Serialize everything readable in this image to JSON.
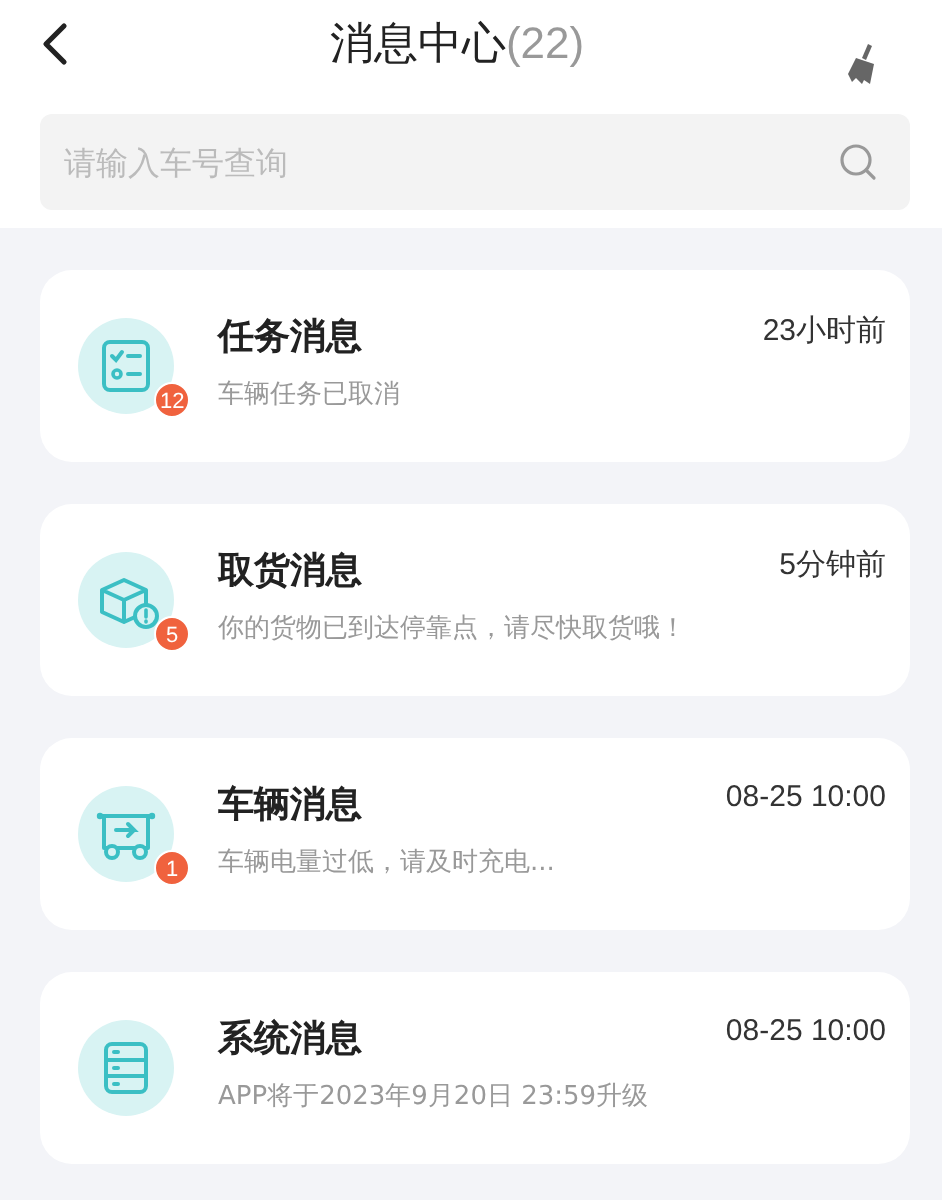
{
  "header": {
    "title": "消息中心",
    "count": "(22)"
  },
  "search": {
    "placeholder": "请输入车号查询"
  },
  "messages": [
    {
      "kind": "task",
      "title": "任务消息",
      "time": "23小时前",
      "preview": "车辆任务已取消",
      "badge": "12"
    },
    {
      "kind": "pickup",
      "title": "取货消息",
      "time": "5分钟前",
      "preview": "你的货物已到达停靠点，请尽快取货哦！",
      "badge": "5"
    },
    {
      "kind": "vehicle",
      "title": "车辆消息",
      "time": "08-25 10:00",
      "preview": "车辆电量过低，请及时充电...",
      "badge": "1"
    },
    {
      "kind": "system",
      "title": "系统消息",
      "time": "08-25 10:00",
      "preview": "APP将于2023年9月20日 23:59升级"
    }
  ]
}
